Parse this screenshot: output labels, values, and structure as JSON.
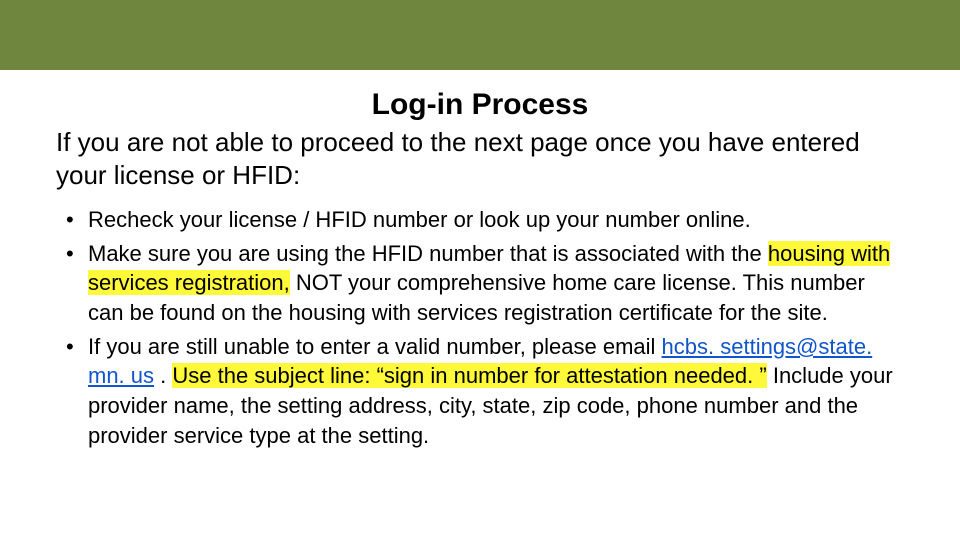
{
  "title": "Log-in Process",
  "intro": "If you are not able to proceed to the next page once you have entered your license or HFID:",
  "bullets": {
    "b1": "Recheck your license / HFID number or look up your number online.",
    "b2_pre": "Make sure you are using the HFID number that is associated with the ",
    "b2_hl": "housing with services registration,",
    "b2_post": " NOT your comprehensive home care license. This number can be found on the housing with services registration certificate for the site.",
    "b3_pre": "If you are still unable to enter a valid number, please email ",
    "b3_email": "hcbs. settings@state. mn. us",
    "b3_mid": " . ",
    "b3_hl": "Use the subject line: “sign in number for attestation needed. ”",
    "b3_post": "   Include your provider name, the setting address, city, state, zip code, phone number and the provider service type at the setting."
  }
}
